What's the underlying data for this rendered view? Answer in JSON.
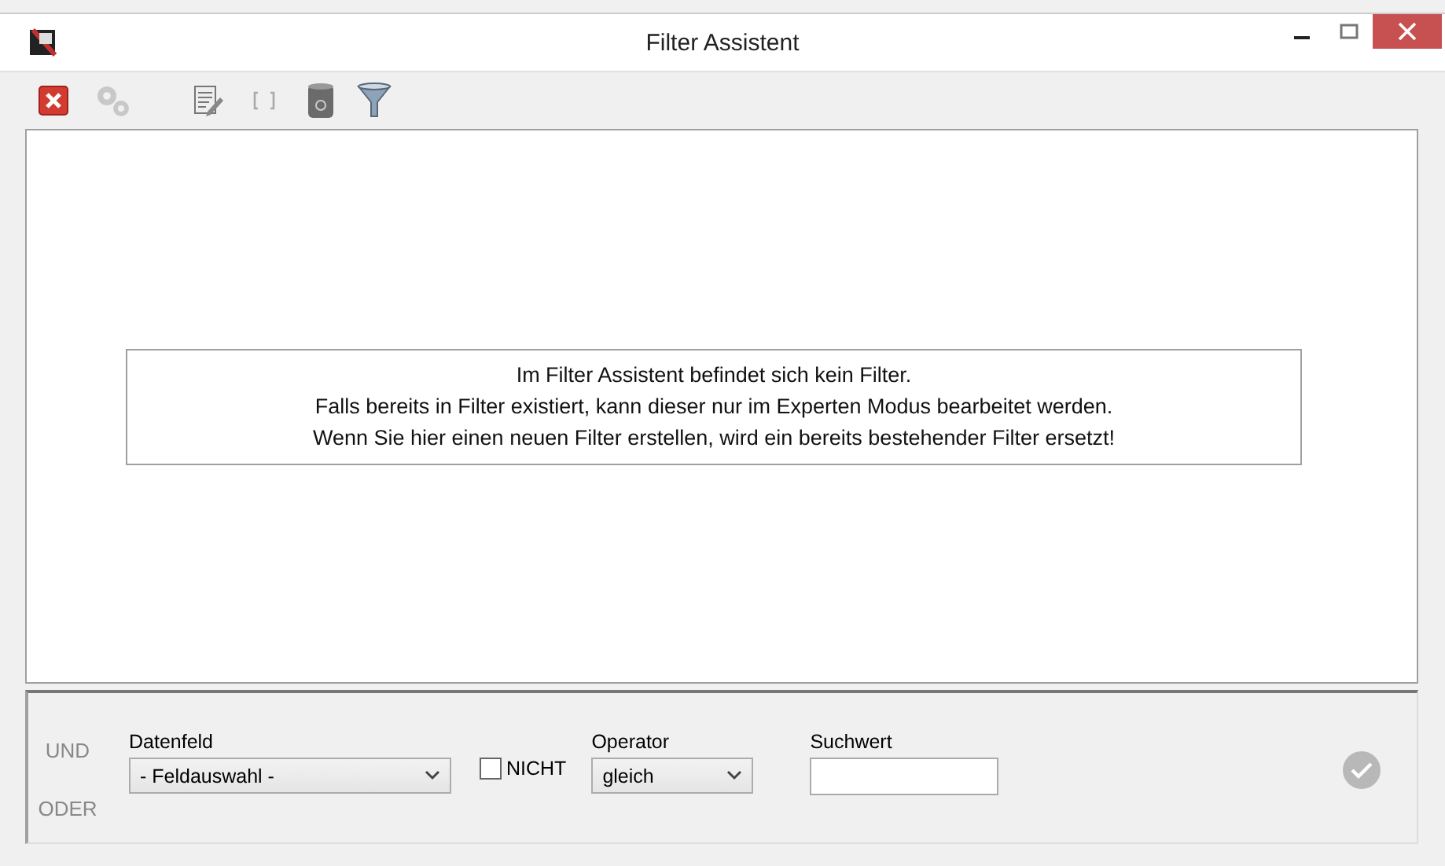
{
  "window": {
    "title": "Filter Assistent"
  },
  "toolbar": [
    {
      "kind": "delete",
      "disabled": false
    },
    {
      "kind": "gears",
      "disabled": true
    },
    {
      "kind": "edit",
      "disabled": false
    },
    {
      "kind": "brackets",
      "disabled": true
    },
    {
      "kind": "trash",
      "disabled": false
    },
    {
      "kind": "funnel",
      "disabled": false
    }
  ],
  "message": [
    "Im Filter Assistent befindet sich kein Filter.",
    "Falls bereits in Filter existiert, kann dieser nur im Experten Modus bearbeitet werden.",
    "Wenn Sie hier einen neuen Filter erstellen, wird ein bereits bestehender Filter ersetzt!"
  ],
  "logic": [
    {
      "label": "UND",
      "disabled": true
    },
    {
      "label": "ODER",
      "disabled": true
    }
  ],
  "datenfeld": {
    "label": "Datenfeld",
    "value": "- Feldauswahl -"
  },
  "nicht": {
    "label": "NICHT",
    "checked": false
  },
  "operator": {
    "label": "Operator",
    "value": "gleich"
  },
  "suchwert": {
    "label": "Suchwert"
  },
  "apply": {
    "disabled": true
  }
}
